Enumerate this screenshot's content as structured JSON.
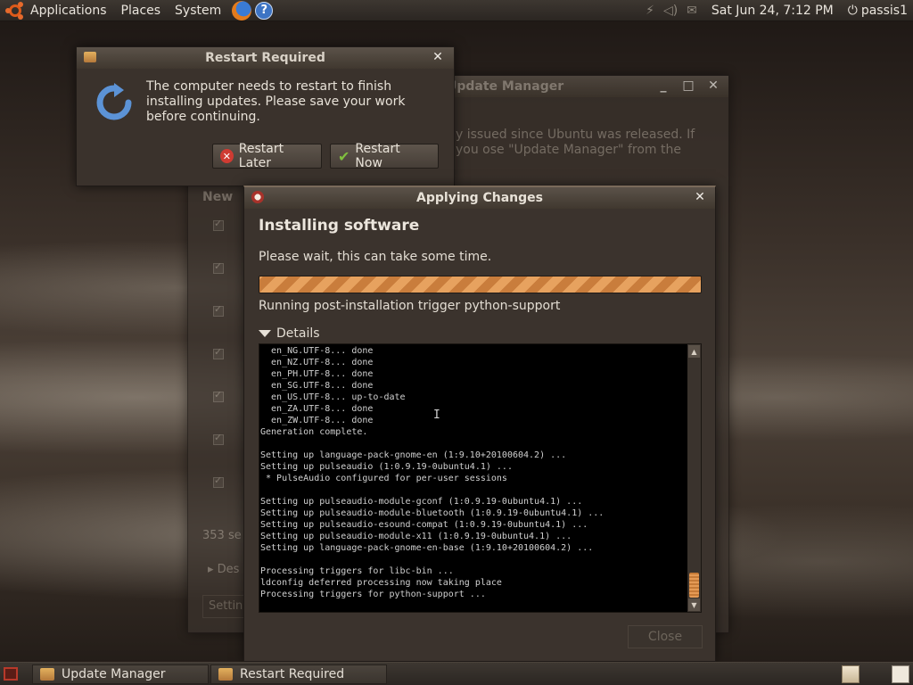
{
  "top_panel": {
    "menus": [
      "Applications",
      "Places",
      "System"
    ],
    "clock": "Sat Jun 24,  7:12 PM",
    "user": "passis1"
  },
  "update_manager": {
    "title": "Update Manager",
    "text": "y issued since Ubuntu was released. If you ose \"Update Manager\" from the",
    "column_head": "New",
    "count": "353 se",
    "desc": "Des",
    "setting": "Settin",
    "window_controls": [
      "_",
      "□",
      "✕"
    ]
  },
  "restart_dialog": {
    "title": "Restart Required",
    "message": "The computer needs to restart to finish installing updates. Please save your work before continuing.",
    "restart_later": "Restart Later",
    "restart_now": "Restart Now",
    "close_glyph": "✕"
  },
  "applying_changes": {
    "title": "Applying Changes",
    "heading": "Installing software",
    "subtitle": "Please wait, this can take some time.",
    "progress_fraction": 1.0,
    "status": "Running post-installation trigger python-support",
    "details_label": "Details",
    "close_label": "Close",
    "close_glyph": "✕",
    "terminal": "  en_NG.UTF-8... done\n  en_NZ.UTF-8... done\n  en_PH.UTF-8... done\n  en_SG.UTF-8... done\n  en_US.UTF-8... up-to-date\n  en_ZA.UTF-8... done\n  en_ZW.UTF-8... done\nGeneration complete.\n\nSetting up language-pack-gnome-en (1:9.10+20100604.2) ...\nSetting up pulseaudio (1:0.9.19-0ubuntu4.1) ...\n * PulseAudio configured for per-user sessions\n\nSetting up pulseaudio-module-gconf (1:0.9.19-0ubuntu4.1) ...\nSetting up pulseaudio-module-bluetooth (1:0.9.19-0ubuntu4.1) ...\nSetting up pulseaudio-esound-compat (1:0.9.19-0ubuntu4.1) ...\nSetting up pulseaudio-module-x11 (1:0.9.19-0ubuntu4.1) ...\nSetting up language-pack-gnome-en-base (1:9.10+20100604.2) ...\n\nProcessing triggers for libc-bin ...\nldconfig deferred processing now taking place\nProcessing triggers for python-support ..."
  },
  "taskbar": {
    "items": [
      "Update Manager",
      "Restart Required"
    ]
  },
  "colors": {
    "accent": "#e7a25f",
    "panel": "#3d3731",
    "window": "#3b332d"
  }
}
